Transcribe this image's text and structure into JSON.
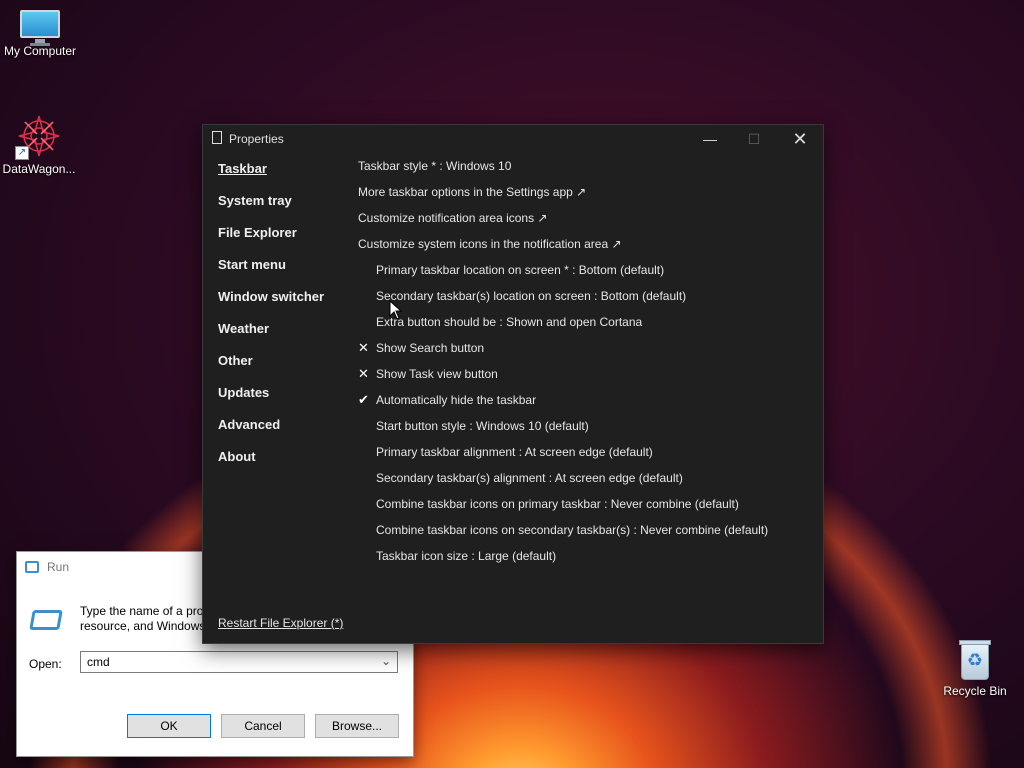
{
  "desktop": {
    "icons": [
      {
        "label": "My Computer",
        "icon": "monitor-icon"
      },
      {
        "label": "DataWagon...",
        "icon": "mandala-icon"
      },
      {
        "label": "Recycle Bin",
        "icon": "recycle-bin-icon"
      }
    ]
  },
  "run_dialog": {
    "title": "Run",
    "description_line1": "Type the name of a pro",
    "description_line2": "resource, and Windows",
    "open_label": "Open:",
    "open_value": "cmd",
    "ok_label": "OK",
    "cancel_label": "Cancel",
    "browse_label": "Browse..."
  },
  "properties": {
    "title": "Properties",
    "window_controls": {
      "minimize": "—",
      "maximize": "☐",
      "close": "✕"
    },
    "nav": [
      "Taskbar",
      "System tray",
      "File Explorer",
      "Start menu",
      "Window switcher",
      "Weather",
      "Other",
      "Updates",
      "Advanced",
      "About"
    ],
    "active_nav": "Taskbar",
    "settings": [
      {
        "text": "Taskbar style * : Windows 10",
        "mark": "",
        "indent": false
      },
      {
        "text": "More taskbar options in the Settings app ↗",
        "mark": "",
        "indent": false
      },
      {
        "text": "Customize notification area icons ↗",
        "mark": "",
        "indent": false
      },
      {
        "text": "Customize system icons in the notification area ↗",
        "mark": "",
        "indent": false
      },
      {
        "text": "Primary taskbar location on screen * : Bottom (default)",
        "mark": "",
        "indent": true
      },
      {
        "text": "Secondary taskbar(s) location on screen : Bottom (default)",
        "mark": "",
        "indent": true
      },
      {
        "text": "Extra button should be : Shown and open Cortana",
        "mark": "",
        "indent": true
      },
      {
        "text": "Show Search button",
        "mark": "✕",
        "indent": true
      },
      {
        "text": "Show Task view button",
        "mark": "✕",
        "indent": true
      },
      {
        "text": "Automatically hide the taskbar",
        "mark": "✔",
        "indent": true
      },
      {
        "text": "Start button style : Windows 10 (default)",
        "mark": "",
        "indent": true
      },
      {
        "text": "Primary taskbar alignment : At screen edge (default)",
        "mark": "",
        "indent": true
      },
      {
        "text": "Secondary taskbar(s) alignment : At screen edge (default)",
        "mark": "",
        "indent": true
      },
      {
        "text": "Combine taskbar icons on primary taskbar : Never combine (default)",
        "mark": "",
        "indent": true
      },
      {
        "text": "Combine taskbar icons on secondary taskbar(s) : Never combine (default)",
        "mark": "",
        "indent": true
      },
      {
        "text": "Taskbar icon size : Large (default)",
        "mark": "",
        "indent": true
      }
    ],
    "restart_link": "Restart File Explorer (*)"
  }
}
